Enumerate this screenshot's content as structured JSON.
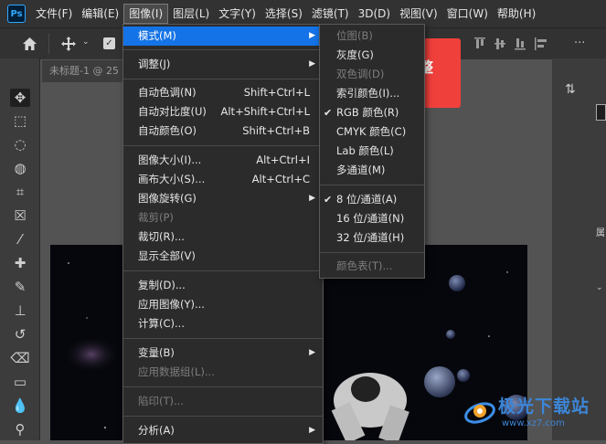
{
  "app": {
    "logo": "Ps"
  },
  "menubar": {
    "items": [
      {
        "label": "文件(F)",
        "active": false
      },
      {
        "label": "编辑(E)",
        "active": false
      },
      {
        "label": "图像(I)",
        "active": true
      },
      {
        "label": "图层(L)",
        "active": false
      },
      {
        "label": "文字(Y)",
        "active": false
      },
      {
        "label": "选择(S)",
        "active": false
      },
      {
        "label": "滤镜(T)",
        "active": false
      },
      {
        "label": "3D(D)",
        "active": false
      },
      {
        "label": "视图(V)",
        "active": false
      },
      {
        "label": "窗口(W)",
        "active": false
      },
      {
        "label": "帮助(H)",
        "active": false
      }
    ]
  },
  "document": {
    "tab_title": "未标题-1 @ 25"
  },
  "background_red_button": {
    "label": "整"
  },
  "image_menu": {
    "items": [
      {
        "label": "模式(M)",
        "shortcut": "",
        "submenu": true,
        "disabled": false,
        "highlighted": true
      },
      {
        "label": "调整(J)",
        "shortcut": "",
        "submenu": true,
        "disabled": false
      },
      {
        "label": "自动色调(N)",
        "shortcut": "Shift+Ctrl+L",
        "disabled": false
      },
      {
        "label": "自动对比度(U)",
        "shortcut": "Alt+Shift+Ctrl+L",
        "disabled": false
      },
      {
        "label": "自动颜色(O)",
        "shortcut": "Shift+Ctrl+B",
        "disabled": false
      },
      {
        "label": "图像大小(I)...",
        "shortcut": "Alt+Ctrl+I",
        "disabled": false
      },
      {
        "label": "画布大小(S)...",
        "shortcut": "Alt+Ctrl+C",
        "disabled": false
      },
      {
        "label": "图像旋转(G)",
        "shortcut": "",
        "submenu": true,
        "disabled": false
      },
      {
        "label": "裁剪(P)",
        "shortcut": "",
        "disabled": true
      },
      {
        "label": "裁切(R)...",
        "shortcut": "",
        "disabled": false
      },
      {
        "label": "显示全部(V)",
        "shortcut": "",
        "disabled": false
      },
      {
        "label": "复制(D)...",
        "shortcut": "",
        "disabled": false
      },
      {
        "label": "应用图像(Y)...",
        "shortcut": "",
        "disabled": false
      },
      {
        "label": "计算(C)...",
        "shortcut": "",
        "disabled": false
      },
      {
        "label": "变量(B)",
        "shortcut": "",
        "submenu": true,
        "disabled": false
      },
      {
        "label": "应用数据组(L)...",
        "shortcut": "",
        "disabled": true
      },
      {
        "label": "陷印(T)...",
        "shortcut": "",
        "disabled": true
      },
      {
        "label": "分析(A)",
        "shortcut": "",
        "submenu": true,
        "disabled": false
      }
    ]
  },
  "mode_submenu": {
    "items": [
      {
        "label": "位图(B)",
        "disabled": true,
        "checked": false
      },
      {
        "label": "灰度(G)",
        "disabled": false,
        "checked": false
      },
      {
        "label": "双色调(D)",
        "disabled": true,
        "checked": false
      },
      {
        "label": "索引颜色(I)...",
        "disabled": false,
        "checked": false
      },
      {
        "label": "RGB 颜色(R)",
        "disabled": false,
        "checked": true
      },
      {
        "label": "CMYK 颜色(C)",
        "disabled": false,
        "checked": false
      },
      {
        "label": "Lab 颜色(L)",
        "disabled": false,
        "checked": false
      },
      {
        "label": "多通道(M)",
        "disabled": false,
        "checked": false
      },
      {
        "label": "8 位/通道(A)",
        "disabled": false,
        "checked": true
      },
      {
        "label": "16 位/通道(N)",
        "disabled": false,
        "checked": false
      },
      {
        "label": "32 位/通道(H)",
        "disabled": false,
        "checked": false
      },
      {
        "label": "颜色表(T)...",
        "disabled": true,
        "checked": false
      }
    ]
  },
  "watermark": {
    "text": "极光下载站",
    "url": "www.xz7.com"
  },
  "icons": {
    "checkmark": "✔",
    "submenu_arrow": "▶"
  },
  "colors": {
    "accent": "#1473e6",
    "menu_bg": "#2b2b2b",
    "app_bg": "#323232",
    "red_button": "#f0403c"
  }
}
